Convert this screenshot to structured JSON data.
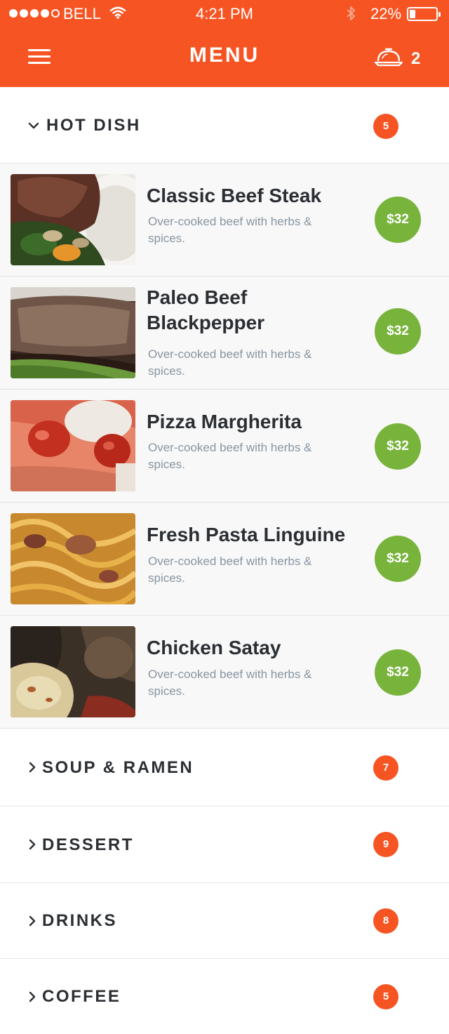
{
  "status_bar": {
    "carrier": "BELL",
    "time": "4:21 PM",
    "battery_percent": "22%",
    "battery_level": 0.22,
    "signal_bars_filled": 4,
    "signal_bars_total": 5
  },
  "header": {
    "title": "MENU",
    "cart_count": "2",
    "menu_icon": "hamburger-icon",
    "cart_icon": "cloche-icon",
    "background_color": "#f65422"
  },
  "categories": [
    {
      "label": "HOT DISH",
      "count": "5",
      "expanded": true
    },
    {
      "label": "SOUP & RAMEN",
      "count": "7",
      "expanded": false
    },
    {
      "label": "DESSERT",
      "count": "9",
      "expanded": false
    },
    {
      "label": "DRINKS",
      "count": "8",
      "expanded": false
    },
    {
      "label": "COFFEE",
      "count": "5",
      "expanded": false
    }
  ],
  "items": [
    {
      "name": "Classic Beef Steak",
      "description": "Over-cooked beef with herbs & spices.",
      "price": "$32"
    },
    {
      "name": "Paleo Beef Blackpepper",
      "description": "Over-cooked beef with herbs & spices.",
      "price": "$32"
    },
    {
      "name": "Pizza Margherita",
      "description": "Over-cooked beef with herbs & spices.",
      "price": "$32"
    },
    {
      "name": "Fresh Pasta Linguine",
      "description": "Over-cooked beef with herbs & spices.",
      "price": "$32"
    },
    {
      "name": "Chicken Satay",
      "description": "Over-cooked beef with herbs & spices.",
      "price": "$32"
    }
  ],
  "colors": {
    "accent": "#f65422",
    "price_badge": "#78b43c",
    "description_text": "#8995a1"
  }
}
